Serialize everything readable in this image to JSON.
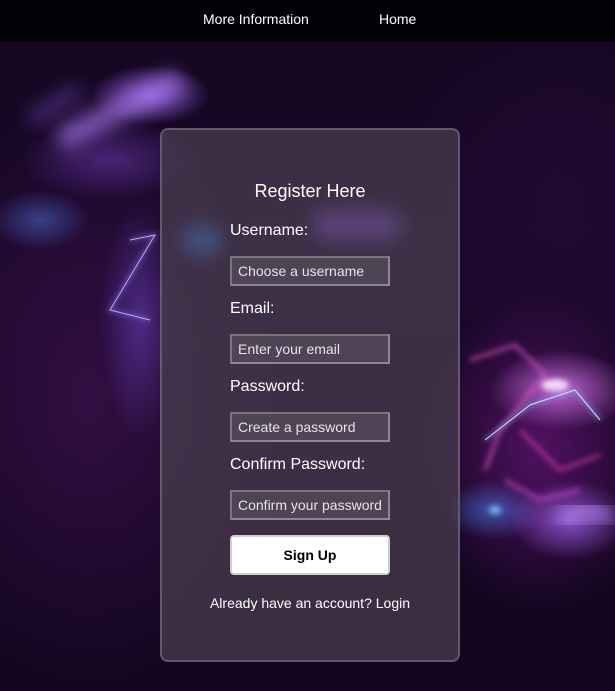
{
  "nav": {
    "more_info": "More Information",
    "home": "Home"
  },
  "form": {
    "title": "Register Here",
    "username_label": "Username:",
    "username_placeholder": "Choose a username",
    "email_label": "Email:",
    "email_placeholder": "Enter your email",
    "password_label": "Password:",
    "password_placeholder": "Create a password",
    "confirm_label": "Confirm Password:",
    "confirm_placeholder": "Confirm your password",
    "submit_label": "Sign Up",
    "footer_text": "Already have an account?",
    "login_link": "Login"
  },
  "colors": {
    "card_background": "#4b3e50",
    "button_background": "#ffffff",
    "navbar_background": "#000000",
    "accent_purple": "#9664e6"
  }
}
